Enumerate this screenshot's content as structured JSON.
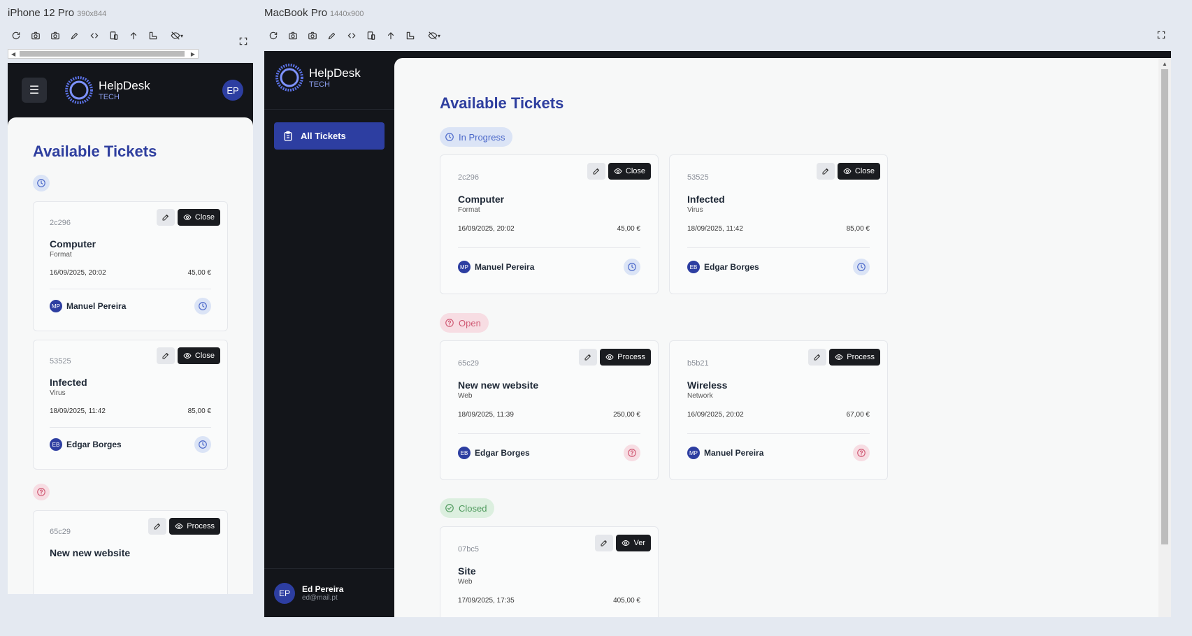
{
  "devices": {
    "phone": {
      "name": "iPhone 12 Pro",
      "size": "390x844"
    },
    "mac": {
      "name": "MacBook Pro",
      "size": "1440x900"
    }
  },
  "app": {
    "brand": "HelpDesk",
    "brand_sub": "TECH",
    "user_initials": "EP",
    "menu_icon": "☰"
  },
  "page": {
    "title": "Available Tickets"
  },
  "sidebar": {
    "nav_all": "All Tickets",
    "user_name": "Ed Pereira",
    "user_email": "ed@mail.pt",
    "user_initials": "EP"
  },
  "groups": {
    "in_progress": "In Progress",
    "open": "Open",
    "closed": "Closed"
  },
  "tickets": [
    {
      "id": "2c296",
      "title": "Computer",
      "category": "Format",
      "date": "16/09/2025, 20:02",
      "price": "45,00 €",
      "assignee": "Manuel Pereira",
      "initials": "MP",
      "status": "progress",
      "action": "Close"
    },
    {
      "id": "53525",
      "title": "Infected",
      "category": "Virus",
      "date": "18/09/2025, 11:42",
      "price": "85,00 €",
      "assignee": "Edgar Borges",
      "initials": "EB",
      "status": "progress",
      "action": "Close"
    },
    {
      "id": "65c29",
      "title": "New new website",
      "category": "Web",
      "date": "18/09/2025, 11:39",
      "price": "250,00 €",
      "assignee": "Edgar Borges",
      "initials": "EB",
      "status": "open",
      "action": "Process"
    },
    {
      "id": "b5b21",
      "title": "Wireless",
      "category": "Network",
      "date": "16/09/2025, 20:02",
      "price": "67,00 €",
      "assignee": "Manuel Pereira",
      "initials": "MP",
      "status": "open",
      "action": "Process"
    },
    {
      "id": "07bc5",
      "title": "Site",
      "category": "Web",
      "date": "17/09/2025, 17:35",
      "price": "405,00 €",
      "action": "Ver"
    }
  ],
  "colors": {
    "accent": "#2d3ea1",
    "title": "#2f3f9f",
    "sidebar_bg": "#13151a",
    "progress": "#4a67c9",
    "open": "#d05a74",
    "closed": "#4f9a5d"
  }
}
